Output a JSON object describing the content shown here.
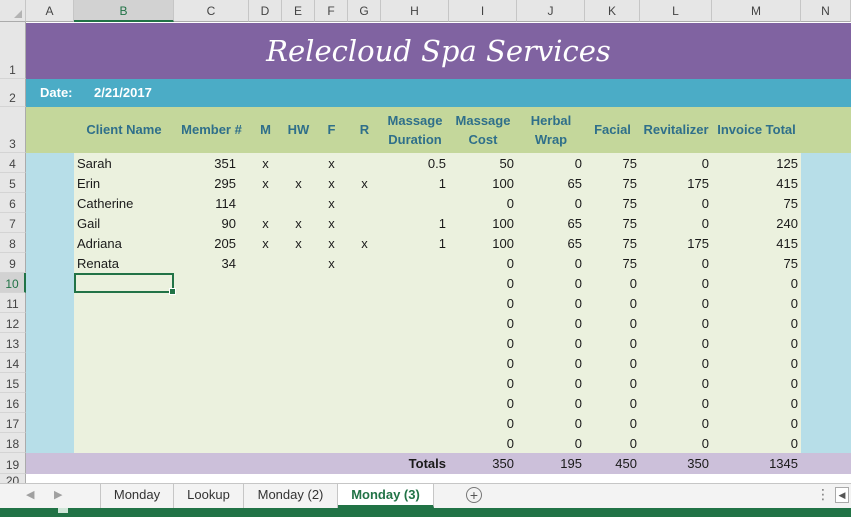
{
  "colors": {
    "title_band": "#8063a1",
    "date_band": "#4bacc6",
    "header_band": "#c4d79b",
    "data_bg": "#ebf1de",
    "side_bg": "#b7dee8",
    "totals_band": "#ccc0da",
    "accent": "#217346"
  },
  "columns": [
    "A",
    "B",
    "C",
    "D",
    "E",
    "F",
    "G",
    "H",
    "I",
    "J",
    "K",
    "L",
    "M",
    "N"
  ],
  "rows": [
    "1",
    "2",
    "3",
    "4",
    "5",
    "6",
    "7",
    "8",
    "9",
    "10",
    "11",
    "12",
    "13",
    "14",
    "15",
    "16",
    "17",
    "18",
    "19",
    "20"
  ],
  "title": "Relecloud Spa Services",
  "date_label": "Date:",
  "date_value": "2/21/2017",
  "headers": {
    "client_name": "Client Name",
    "member_num": "Member #",
    "m": "M",
    "hw": "HW",
    "f": "F",
    "r": "R",
    "massage_duration_1": "Massage",
    "massage_duration_2": "Duration",
    "massage_cost_1": "Massage",
    "massage_cost_2": "Cost",
    "herbal_wrap_1": "Herbal",
    "herbal_wrap_2": "Wrap",
    "facial": "Facial",
    "revitalizer": "Revitalizer",
    "invoice_total": "Invoice Total"
  },
  "table": [
    {
      "name": "Sarah",
      "member": "351",
      "m": "x",
      "hw": "",
      "f": "x",
      "r": "",
      "duration": "0.5",
      "mcost": "50",
      "wrap": "0",
      "facial": "75",
      "revit": "0",
      "total": "125"
    },
    {
      "name": "Erin",
      "member": "295",
      "m": "x",
      "hw": "x",
      "f": "x",
      "r": "x",
      "duration": "1",
      "mcost": "100",
      "wrap": "65",
      "facial": "75",
      "revit": "175",
      "total": "415"
    },
    {
      "name": "Catherine",
      "member": "114",
      "m": "",
      "hw": "",
      "f": "x",
      "r": "",
      "duration": "",
      "mcost": "0",
      "wrap": "0",
      "facial": "75",
      "revit": "0",
      "total": "75"
    },
    {
      "name": "Gail",
      "member": "90",
      "m": "x",
      "hw": "x",
      "f": "x",
      "r": "",
      "duration": "1",
      "mcost": "100",
      "wrap": "65",
      "facial": "75",
      "revit": "0",
      "total": "240"
    },
    {
      "name": "Adriana",
      "member": "205",
      "m": "x",
      "hw": "x",
      "f": "x",
      "r": "x",
      "duration": "1",
      "mcost": "100",
      "wrap": "65",
      "facial": "75",
      "revit": "175",
      "total": "415"
    },
    {
      "name": "Renata",
      "member": "34",
      "m": "",
      "hw": "",
      "f": "x",
      "r": "",
      "duration": "",
      "mcost": "0",
      "wrap": "0",
      "facial": "75",
      "revit": "0",
      "total": "75"
    },
    {
      "name": "",
      "member": "",
      "m": "",
      "hw": "",
      "f": "",
      "r": "",
      "duration": "",
      "mcost": "0",
      "wrap": "0",
      "facial": "0",
      "revit": "0",
      "total": "0"
    },
    {
      "name": "",
      "member": "",
      "m": "",
      "hw": "",
      "f": "",
      "r": "",
      "duration": "",
      "mcost": "0",
      "wrap": "0",
      "facial": "0",
      "revit": "0",
      "total": "0"
    },
    {
      "name": "",
      "member": "",
      "m": "",
      "hw": "",
      "f": "",
      "r": "",
      "duration": "",
      "mcost": "0",
      "wrap": "0",
      "facial": "0",
      "revit": "0",
      "total": "0"
    },
    {
      "name": "",
      "member": "",
      "m": "",
      "hw": "",
      "f": "",
      "r": "",
      "duration": "",
      "mcost": "0",
      "wrap": "0",
      "facial": "0",
      "revit": "0",
      "total": "0"
    },
    {
      "name": "",
      "member": "",
      "m": "",
      "hw": "",
      "f": "",
      "r": "",
      "duration": "",
      "mcost": "0",
      "wrap": "0",
      "facial": "0",
      "revit": "0",
      "total": "0"
    },
    {
      "name": "",
      "member": "",
      "m": "",
      "hw": "",
      "f": "",
      "r": "",
      "duration": "",
      "mcost": "0",
      "wrap": "0",
      "facial": "0",
      "revit": "0",
      "total": "0"
    },
    {
      "name": "",
      "member": "",
      "m": "",
      "hw": "",
      "f": "",
      "r": "",
      "duration": "",
      "mcost": "0",
      "wrap": "0",
      "facial": "0",
      "revit": "0",
      "total": "0"
    },
    {
      "name": "",
      "member": "",
      "m": "",
      "hw": "",
      "f": "",
      "r": "",
      "duration": "",
      "mcost": "0",
      "wrap": "0",
      "facial": "0",
      "revit": "0",
      "total": "0"
    },
    {
      "name": "",
      "member": "",
      "m": "",
      "hw": "",
      "f": "",
      "r": "",
      "duration": "",
      "mcost": "0",
      "wrap": "0",
      "facial": "0",
      "revit": "0",
      "total": "0"
    }
  ],
  "totals": {
    "label": "Totals",
    "mcost": "350",
    "wrap": "195",
    "facial": "450",
    "revit": "350",
    "total": "1345"
  },
  "sheet_tabs": [
    "Monday",
    "Lookup",
    "Monday (2)",
    "Monday (3)"
  ],
  "active_tab": "Monday (3)",
  "icons": {
    "prev_sheet": "◀",
    "next_sheet": "▶",
    "add_sheet": "+",
    "tab_menu": "⋮",
    "scroll_left": "◀"
  }
}
